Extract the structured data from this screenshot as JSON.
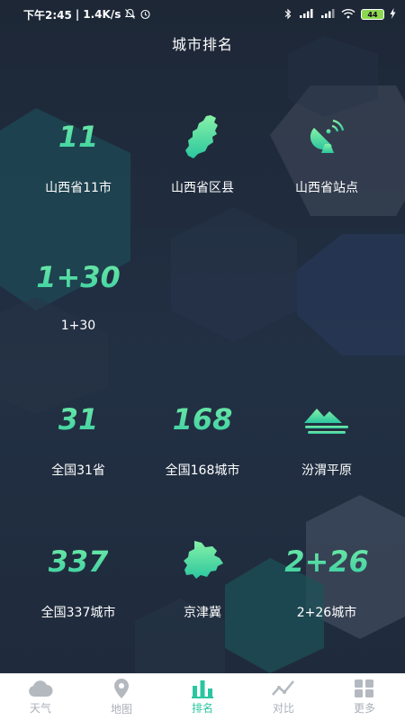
{
  "status_bar": {
    "time": "下午2:45",
    "net_speed": "1.4K/s",
    "battery": "44"
  },
  "page": {
    "title": "城市排名"
  },
  "grid": [
    {
      "id": "shanxi-11",
      "big": "11",
      "label": "山西省11市"
    },
    {
      "id": "shanxi-county",
      "icon": "shanxi-map-icon",
      "label": "山西省区县"
    },
    {
      "id": "shanxi-station",
      "icon": "satellite-dish-icon",
      "label": "山西省站点"
    },
    {
      "id": "plus-30",
      "big": "1+30",
      "label": "1+30"
    },
    {
      "id": "national-31",
      "big": "31",
      "label": "全国31省"
    },
    {
      "id": "national-168",
      "big": "168",
      "label": "全国168城市"
    },
    {
      "id": "fenwei",
      "icon": "mountain-plain-icon",
      "label": "汾渭平原"
    },
    {
      "id": "national-337",
      "big": "337",
      "label": "全国337城市"
    },
    {
      "id": "jingjinji",
      "icon": "jingjinji-map-icon",
      "label": "京津冀"
    },
    {
      "id": "two-plus-26",
      "big": "2+26",
      "label": "2+26城市"
    }
  ],
  "tabs": [
    {
      "label": "天气",
      "icon": "cloud-icon",
      "active": false
    },
    {
      "label": "地图",
      "icon": "map-pin-icon",
      "active": false
    },
    {
      "label": "排名",
      "icon": "bar-chart-icon",
      "active": true
    },
    {
      "label": "对比",
      "icon": "trend-line-icon",
      "active": false
    },
    {
      "label": "更多",
      "icon": "grid-icon",
      "active": false
    }
  ],
  "colors": {
    "accent": "#2bc6a0",
    "accent_light": "#7ff3a8",
    "background": "#1f2a3a",
    "tab_inactive": "#aab0b8"
  }
}
